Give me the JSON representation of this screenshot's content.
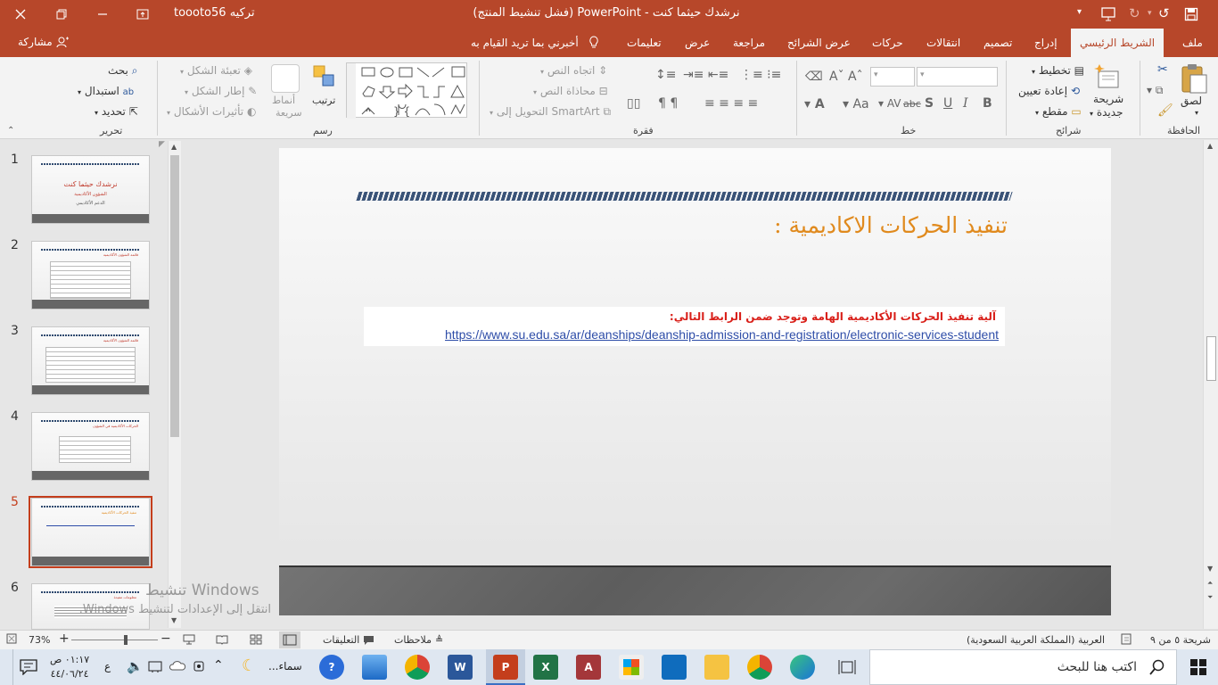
{
  "titlebar": {
    "title": "نرشدك حيثما كنت  -  PowerPoint (فشل تنشيط المنتج)",
    "account": "toooto56 تركيه"
  },
  "menu": {
    "file": "ملف",
    "home": "الشريط الرئيسي",
    "insert": "إدراج",
    "design": "تصميم",
    "transitions": "انتقالات",
    "animations": "حركات",
    "slideshow": "عرض الشرائح",
    "review": "مراجعة",
    "view": "عرض",
    "help": "تعليمات",
    "tellme": "أخبرني بما تريد القيام به",
    "share": "مشاركة"
  },
  "ribbon": {
    "clipboard": {
      "label": "الحافظة",
      "paste": "لصق"
    },
    "slides": {
      "label": "شرائح",
      "new_slide_1": "شريحة",
      "new_slide_2": "جديدة",
      "layout": "تخطيط",
      "reset": "إعادة تعيين",
      "section": "مقطع"
    },
    "font": {
      "label": "خط"
    },
    "paragraph": {
      "label": "فقرة",
      "text_direction": "اتجاه النص",
      "align_text": "محاذاة النص",
      "smartart": "التحويل إلى SmartArt"
    },
    "drawing": {
      "label": "رسم",
      "arrange": "ترتيب",
      "quick_styles_1": "أنماط",
      "quick_styles_2": "سريعة",
      "fill": "تعبئة الشكل",
      "outline": "إطار الشكل",
      "effects": "تأثيرات الأشكال"
    },
    "editing": {
      "label": "تحرير",
      "find": "بحث",
      "replace": "استبدال",
      "select": "تحديد"
    }
  },
  "thumbnails": [
    {
      "number": "1",
      "title": "نرشدك حيثما كنت",
      "sub1": "الشؤون الأكاديمية",
      "sub2": "الدعم الأكاديمي"
    },
    {
      "number": "2",
      "title": "قائمة الشؤون الأكاديمية"
    },
    {
      "number": "3",
      "title": "قائمة الشؤون الأكاديمية"
    },
    {
      "number": "4",
      "title": "الحركات الأكاديمية في الشؤون"
    },
    {
      "number": "5",
      "title": "تنفيذ الحركات الأكاديمية"
    },
    {
      "number": "6",
      "title": "معلومات مفيدة"
    }
  ],
  "slide": {
    "title": "تنفيذ الحركات الاكاديمية :",
    "body_heading": "آلية تنفيذ الحركات الأكاديمية الهامة وتوجد ضمن الرابط التالي:",
    "link": "https://www.su.edu.sa/ar/deanships/deanship-admission-and-registration/electronic-services-student"
  },
  "watermark": {
    "line1": "تنشيط Windows",
    "line2": "انتقل إلى الإعدادات لتنشيط Windows."
  },
  "statusbar": {
    "slide_counter": "شريحة ٥ من ٩",
    "language": "العربية (المملكة العربية السعودية)",
    "notes": "ملاحظات",
    "comments": "التعليقات",
    "zoom": "73%"
  },
  "taskbar": {
    "search_placeholder": "اكتب هنا للبحث",
    "time": "٠١:١٧ ص",
    "date": "٤٤/٠٦/٢٤",
    "weather": "سماء...",
    "lang": "ع"
  },
  "colors": {
    "accent": "#b7472a",
    "slide_title": "#e08a1e",
    "slide_heading": "#d9201a",
    "link": "#2e4da8"
  }
}
